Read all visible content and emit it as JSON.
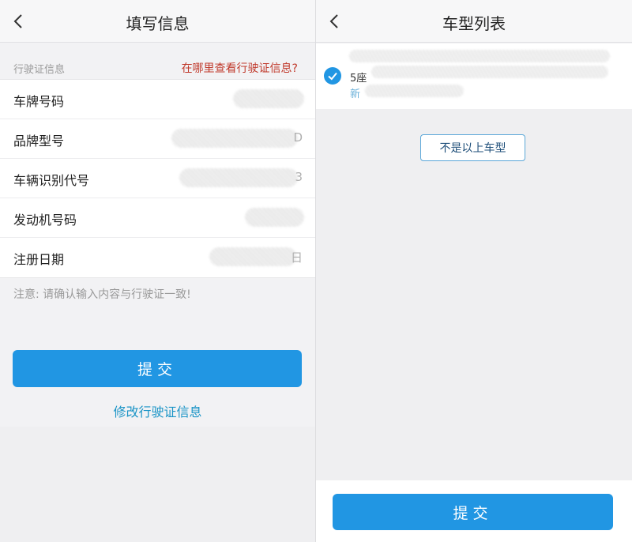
{
  "left_screen": {
    "title": "填写信息",
    "section_label": "行驶证信息",
    "help_link": "在哪里查看行驶证信息?",
    "fields": [
      {
        "label": "车牌号码",
        "tail": ""
      },
      {
        "label": "品牌型号",
        "tail": "D"
      },
      {
        "label": "车辆识别代号",
        "tail": "3"
      },
      {
        "label": "发动机号码",
        "tail": ""
      },
      {
        "label": "注册日期",
        "tail": "日"
      }
    ],
    "notice": "注意: 请确认输入内容与行驶证一致!",
    "submit_label": "提交",
    "edit_link": "修改行驶证信息"
  },
  "right_screen": {
    "title": "车型列表",
    "vehicle": {
      "seats": "5座",
      "tag": "新",
      "selected": true
    },
    "other_model_button": "不是以上车型",
    "submit_label": "提交"
  },
  "colors": {
    "primary_blue": "#2196e3",
    "link_red": "#c0392b",
    "link_blue": "#1a94c6"
  },
  "icons": [
    "chevron-left-icon",
    "checkmark-circle-icon"
  ]
}
